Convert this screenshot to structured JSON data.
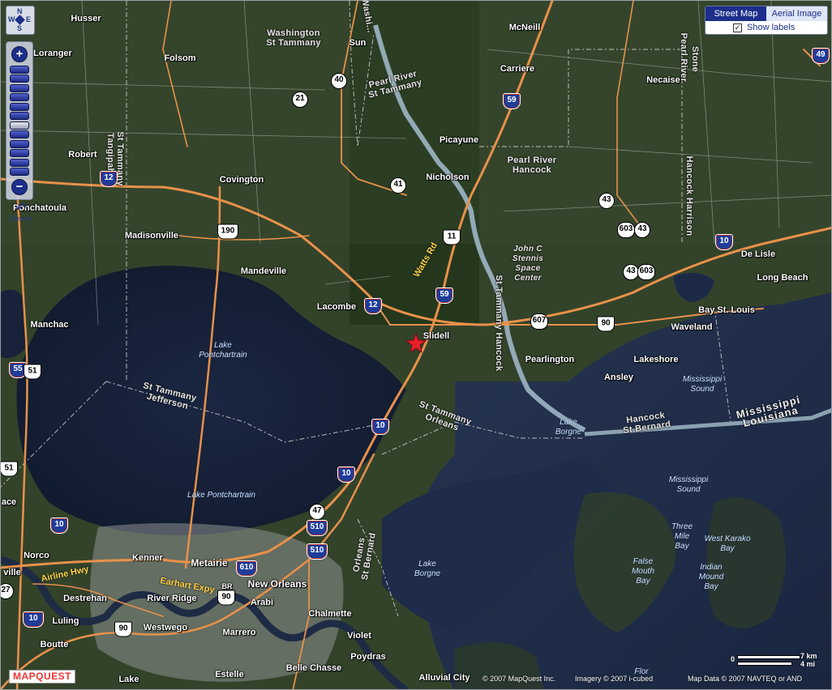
{
  "map": {
    "places": [
      {
        "id": "husser",
        "name": "Husser"
      },
      {
        "id": "loranger",
        "name": "Loranger"
      },
      {
        "id": "folsom",
        "name": "Folsom"
      },
      {
        "id": "sun",
        "name": "Sun"
      },
      {
        "id": "mcneill",
        "name": "McNeill"
      },
      {
        "id": "carriere",
        "name": "Carriere"
      },
      {
        "id": "necaise",
        "name": "Necaise"
      },
      {
        "id": "picayune",
        "name": "Picayune"
      },
      {
        "id": "robert",
        "name": "Robert"
      },
      {
        "id": "covington",
        "name": "Covington"
      },
      {
        "id": "nicholson",
        "name": "Nicholson"
      },
      {
        "id": "ponchatoula",
        "name": "Ponchatoula"
      },
      {
        "id": "madisonville",
        "name": "Madisonville"
      },
      {
        "id": "mandeville",
        "name": "Mandeville"
      },
      {
        "id": "lacombe",
        "name": "Lacombe"
      },
      {
        "id": "slidell",
        "name": "Slidell"
      },
      {
        "id": "manchac",
        "name": "Manchac"
      },
      {
        "id": "delisle",
        "name": "De Lisle"
      },
      {
        "id": "longbeach",
        "name": "Long Beach"
      },
      {
        "id": "baystlouis",
        "name": "Bay St. Louis"
      },
      {
        "id": "waveland",
        "name": "Waveland"
      },
      {
        "id": "pearlington",
        "name": "Pearlington"
      },
      {
        "id": "lakeshore",
        "name": "Lakeshore"
      },
      {
        "id": "ansley",
        "name": "Ansley"
      },
      {
        "id": "norco",
        "name": "Norco"
      },
      {
        "id": "kenner",
        "name": "Kenner"
      },
      {
        "id": "metairie",
        "name": "Metairie"
      },
      {
        "id": "neworleans",
        "name": "New Orleans"
      },
      {
        "id": "destrehan",
        "name": "Destrehan"
      },
      {
        "id": "riverridge",
        "name": "River Ridge"
      },
      {
        "id": "arabi",
        "name": "Arabi"
      },
      {
        "id": "chalmette",
        "name": "Chalmette"
      },
      {
        "id": "luling",
        "name": "Luling"
      },
      {
        "id": "westwego",
        "name": "Westwego"
      },
      {
        "id": "marrero",
        "name": "Marrero"
      },
      {
        "id": "violet",
        "name": "Violet"
      },
      {
        "id": "boutte",
        "name": "Boutte"
      },
      {
        "id": "poydras",
        "name": "Poydras"
      },
      {
        "id": "estelle",
        "name": "Estelle"
      },
      {
        "id": "bellechasse",
        "name": "Belle Chasse"
      },
      {
        "id": "alluvialcity",
        "name": "Alluvial City"
      },
      {
        "id": "br",
        "name": "BR"
      },
      {
        "id": "ville",
        "name": "ville"
      },
      {
        "id": "ace",
        "name": "ace"
      },
      {
        "id": "lake",
        "name": "Lake"
      }
    ],
    "regions": {
      "washington_sttammany": "Washington\nSt Tammany",
      "pearlriver_sttammany": "Pearl River\nSt Tammany",
      "pearlriver_hancock": "Pearl River\nHancock",
      "sttammany_tangipahoa": "St Tammany\nTangipahoa",
      "pearl_river_v": "Pearl River",
      "stone": "Stone",
      "hancock_harrison": "Hancock  Harrison",
      "stennis": "John C\nStennis\nSpace\nCenter",
      "sttammany_hancock": "St Tammany  Hancock",
      "sttammany_jefferson": "St Tammany\nJefferson",
      "sttammany_orleans": "St Tammany\nOrleans",
      "hancock_stbernard": "Hancock\nSt Bernard",
      "orleans_stbernard": "Orleans\nSt Bernard",
      "mississippi_louisiana": "Mississippi\nLouisiana",
      "washington_top": "Washi..."
    },
    "water": {
      "lake_pontchartrain_1": "Lake\nPontchartrain",
      "lake_pontchartrain_2": "Lake Pontchartrain",
      "lake_borgne_1": "Lake\nBorgne",
      "lake_borgne_2": "Lake\nBorgne",
      "mississippi_sound_1": "Mississippi\nSound",
      "mississippi_sound_2": "Mississippi\nSound",
      "three_mile_bay": "Three\nMile\nBay",
      "west_karako_bay": "West Karako\nBay",
      "false_mouth_bay": "False\nMouth\nBay",
      "indian_mound_bay": "Indian\nMound\nBay",
      "flor": "Flor"
    },
    "roads": {
      "watts_rd": "Watts Rd",
      "airline_hwy": "Airline Hwy",
      "earhart_expy": "Earhart Expy"
    },
    "shields": {
      "i12a": "12",
      "i12b": "12",
      "i59a": "59",
      "i59b": "59",
      "i10a": "10",
      "i10b": "10",
      "i10c": "10",
      "i10d": "10",
      "i10e": "10",
      "i55": "55",
      "i510a": "510",
      "i510b": "510",
      "i610": "610",
      "i49": "49",
      "us11": "11",
      "us190": "190",
      "us90a": "90",
      "us90b": "90",
      "us90c": "90",
      "us51a": "51",
      "us51b": "51",
      "s40": "40",
      "s21": "21",
      "s41": "41",
      "s43a": "43",
      "s43b": "43",
      "s43c": "43",
      "s603a": "603",
      "s603b": "603",
      "s607": "607",
      "s47": "47",
      "s27": "27"
    },
    "marker": {
      "name": "location-star",
      "color": "#e8202a"
    }
  },
  "nav": {
    "zoom_in": "+",
    "zoom_out": "−",
    "revert": "Revert",
    "pan_n": "N",
    "pan_s": "S",
    "pan_e": "E",
    "pan_w": "W",
    "zoom_levels": 12,
    "active_level": 6
  },
  "maptype": {
    "street": "Street Map",
    "aerial": "Aerial Image",
    "show_labels": "Show labels",
    "show_labels_checked": "✓"
  },
  "footer": {
    "logo": "MAPQUEST",
    "copyright_mq": "© 2007 MapQuest Inc.",
    "copyright_imagery": "Imagery © 2007 i-cubed",
    "copyright_mapdata": "Map Data © 2007 NAVTEQ or AND",
    "scale_km": "7 km",
    "scale_mi": "4 mi",
    "scale_zero": "0"
  },
  "colors": {
    "land": "#2e3e27",
    "forest": "#26391f",
    "water": "#1a2540",
    "highway": "#e8914a",
    "river": "#9fb6c6",
    "accent": "#1d2f8a"
  }
}
